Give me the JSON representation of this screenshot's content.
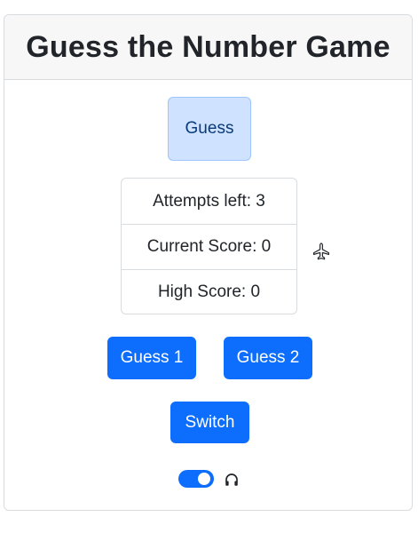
{
  "header": {
    "title": "Guess the Number Game"
  },
  "main": {
    "guess_label": "Guess",
    "stats": {
      "attempts": "Attempts left: 3",
      "current_score": "Current Score: 0",
      "high_score": "High Score: 0"
    },
    "buttons": {
      "guess1": "Guess 1",
      "guess2": "Guess 2",
      "switch": "Switch"
    },
    "toggle_on": true
  },
  "icons": {
    "plane": "airplane-icon",
    "audio": "headphones-icon"
  },
  "colors": {
    "primary": "#0d6efd",
    "guess_bg": "#cfe2ff",
    "header_bg": "#f7f7f7"
  }
}
